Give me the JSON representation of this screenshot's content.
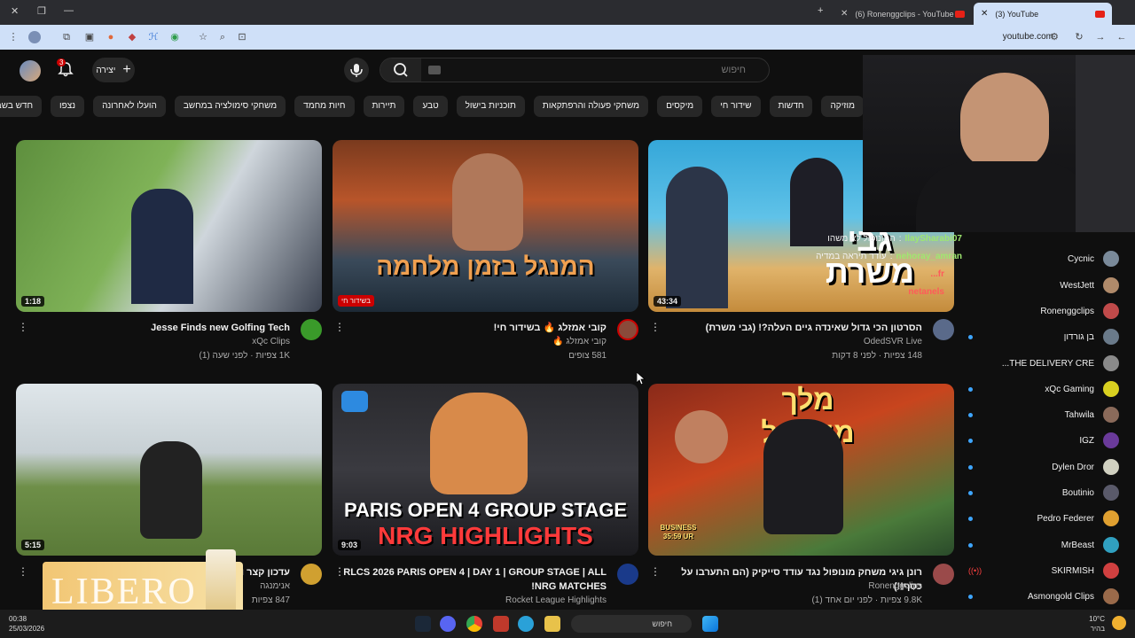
{
  "browser": {
    "tabs": [
      {
        "title": "(6) Ronenggclips - YouTube",
        "active": false
      },
      {
        "title": "(3) YouTube",
        "active": true
      }
    ],
    "url": "youtube.com"
  },
  "header": {
    "search_placeholder": "חיפוש",
    "create_label": "יצירה",
    "notifications_count": "3"
  },
  "chips": [
    "מוזיקה",
    "חדשות",
    "שידור חי",
    "מיקסים",
    "משחקי פעולה והרפתקאות",
    "תוכניות בישול",
    "טבע",
    "תיירות",
    "חיות מחמד",
    "משחקי סימולציה במחשב",
    "הועלו לאחרונה",
    "נצפו",
    "חדש בשבילך"
  ],
  "videos": [
    {
      "title": "Jesse Finds new Golfing Tech",
      "channel": "xQc Clips",
      "stats": "1K צפיות · לפני שעה (1)",
      "duration": "1:18"
    },
    {
      "title": "קובי אמזלג 🔥 בשידור חי!",
      "channel": "קובי אמזלג 🔥",
      "stats": "581 צופים",
      "live": "בשידור חי"
    },
    {
      "title": "הסרטון הכי גדול שאינדה גיים העלה?! (גבי משרת)",
      "channel": "OdedSVR Live",
      "stats": "148 צפיות · לפני 8 דקות",
      "duration": "43:34"
    },
    {
      "title": "עדכון קצר וש...",
      "channel": "אנימנגה",
      "stats": "847 צפיות",
      "duration": "5:15"
    },
    {
      "title": "RLCS 2026 PARIS OPEN 4 | DAY 1 | GROUP STAGE | ALL NRG MATCHES!",
      "channel": "Rocket League Highlights",
      "stats": "",
      "duration": "9:03"
    },
    {
      "title": "רונן גיגי משחק מונופול נגד עודד סייקיק (הם התערבו על כסף!!)",
      "channel": "Ronenggclips",
      "stats": "9.8K צפיות · לפני יום אחד (1)",
      "duration": ""
    }
  ],
  "thumb_text": {
    "t2": "המנגל בזמן מלחמה",
    "t3": "גבי משרת",
    "t5_line1": "PARIS OPEN 4 GROUP STAGE",
    "t5_line2": "NRG HIGHLIGHTS",
    "t6": "מלך מונופול",
    "t6_badge": "BUSINESS 35:59 UR"
  },
  "subscriptions": [
    {
      "name": "Cycnic",
      "dot": false
    },
    {
      "name": "WestJett",
      "dot": false
    },
    {
      "name": "Ronenggclips",
      "dot": false
    },
    {
      "name": "בן גורדון",
      "dot": true
    },
    {
      "name": "THE DELIVERY CRE...",
      "dot": false
    },
    {
      "name": "xQc Gaming",
      "dot": true
    },
    {
      "name": "Tahwila",
      "dot": true
    },
    {
      "name": "IGZ",
      "dot": true
    },
    {
      "name": "Dylen Dror",
      "dot": true
    },
    {
      "name": "Boutinio",
      "dot": true
    },
    {
      "name": "Pedro Federer",
      "dot": true
    },
    {
      "name": "MrBeast",
      "dot": true
    },
    {
      "name": "SKIRMISH",
      "dot": true
    },
    {
      "name": "Asmongold Clips",
      "dot": true
    }
  ],
  "chat": [
    {
      "user": "IlaySharabi07",
      "msg": "המונופול לא משהו"
    },
    {
      "user": "nehoray_amran",
      "msg": "עודד תיראה במדיה"
    },
    {
      "user": "fr...",
      "msg": ""
    },
    {
      "user": "netanels",
      "msg": ""
    }
  ],
  "promo": {
    "text": "LIBERO"
  },
  "taskbar": {
    "time": "00:38",
    "date": "25/03/2026",
    "search": "חיפוש",
    "temp": "10°C",
    "weather": "בהיר"
  },
  "colors": {
    "yt_red": "#cc0000",
    "bg": "#0f0f0f",
    "chip": "#272727",
    "accent_blue": "#3ea6ff"
  }
}
